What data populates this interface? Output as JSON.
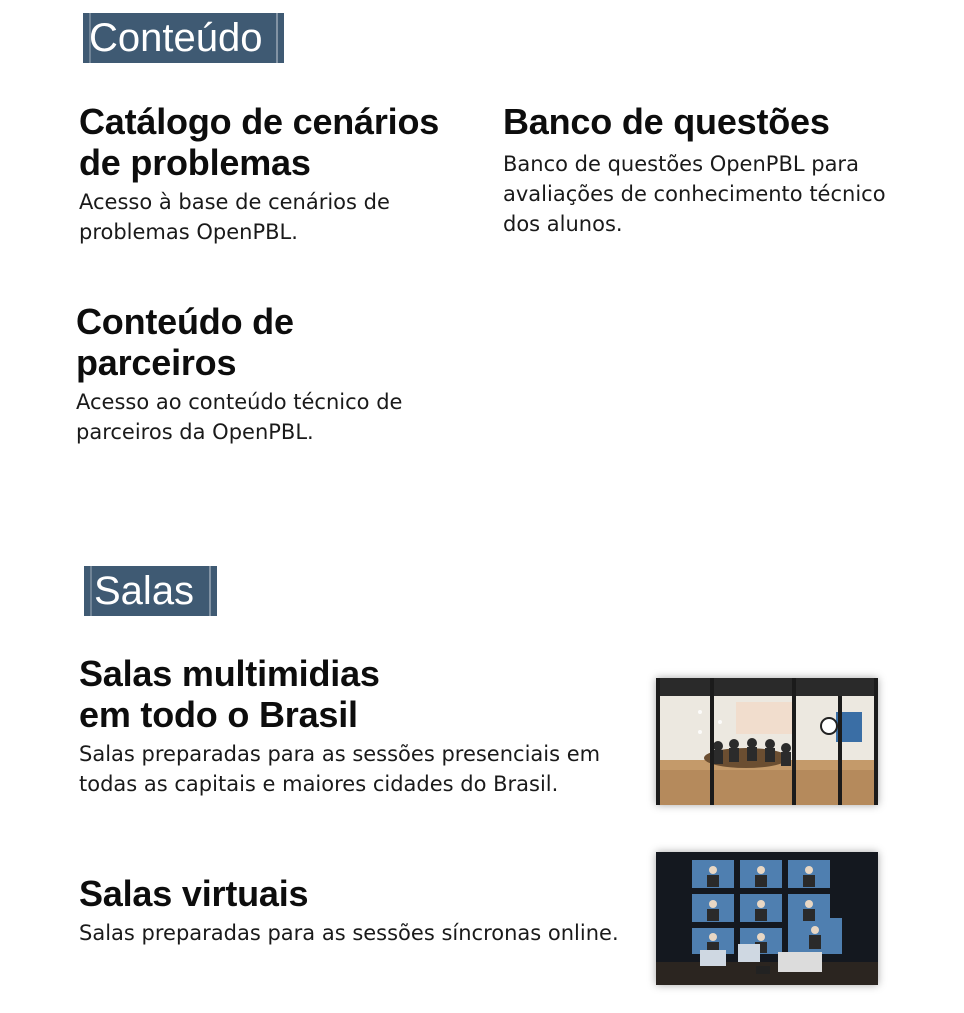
{
  "conteudo": {
    "label": "Conteúdo",
    "items": [
      {
        "title_line1": "Catálogo de cenários",
        "title_line2": "de problemas",
        "description": "Acesso à base de cenários de problemas OpenPBL."
      },
      {
        "title_line1": "Banco de questões",
        "title_line2": "",
        "description": "Banco de questões OpenPBL para avaliações de conhecimento técnico dos alunos."
      },
      {
        "title_line1": "Conteúdo de",
        "title_line2": "parceiros",
        "description": "Acesso ao conteúdo técnico de parceiros da OpenPBL."
      }
    ]
  },
  "salas": {
    "label": "Salas",
    "items": [
      {
        "title_line1": "Salas multimidias",
        "title_line2": "em todo o Brasil",
        "description": "Salas preparadas para as sessões presenciais em todas as capitais e maiores cidades do Brasil.",
        "image": "meeting-room-photo"
      },
      {
        "title_line1": "Salas virtuais",
        "title_line2": "",
        "description": "Salas preparadas para as sessões síncronas online.",
        "image": "video-conference-photo"
      }
    ]
  },
  "colors": {
    "section_label_bg": "#3f5a73",
    "section_label_text": "#ffffff"
  }
}
